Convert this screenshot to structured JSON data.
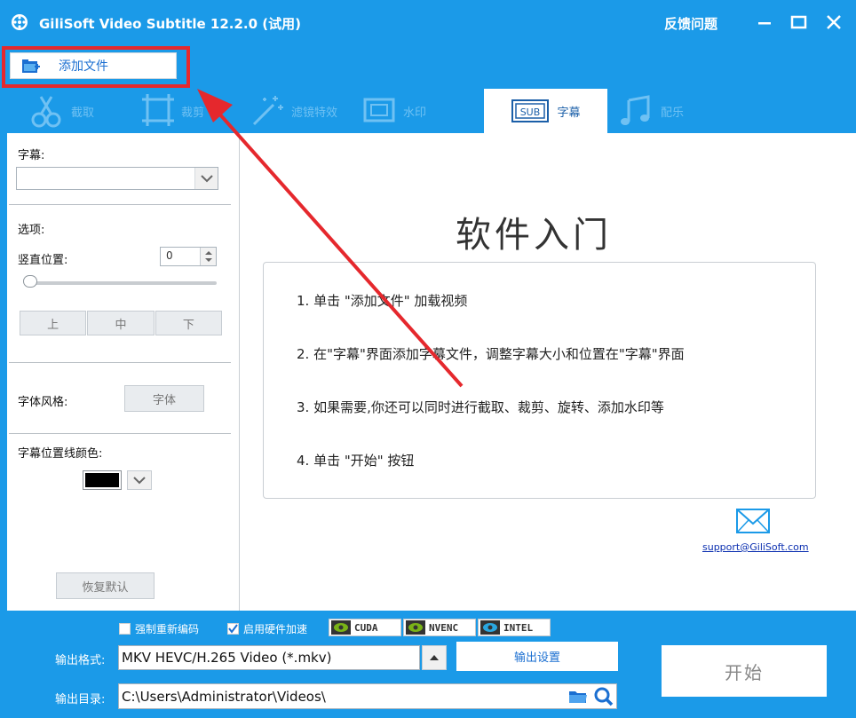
{
  "window": {
    "title": "GiliSoft Video Subtitle 12.2.0 (试用)",
    "feedback": "反馈问题"
  },
  "toolbar": {
    "add_file_label": "添加文件"
  },
  "tabs": [
    {
      "label": "截取"
    },
    {
      "label": "裁剪"
    },
    {
      "label": "滤镜特效"
    },
    {
      "label": "水印"
    },
    {
      "label": "字幕",
      "icon_text": "SUB"
    },
    {
      "label": "配乐"
    }
  ],
  "left_panel": {
    "subtitle_label": "字幕:",
    "subtitle_value": "",
    "options_label": "选项:",
    "vertical_position_label": "竖直位置:",
    "vertical_position_value": "0",
    "position_buttons": [
      "上",
      "中",
      "下"
    ],
    "font_style_label": "字体风格:",
    "font_button": "字体",
    "line_color_label": "字幕位置线颜色:",
    "line_color": "#000000",
    "reset_button": "恢复默认"
  },
  "guide": {
    "title": "软件入门",
    "steps": [
      "1. 单击 \"添加文件\" 加载视频",
      "2. 在\"字幕\"界面添加字幕文件，调整字幕大小和位置在\"字幕\"界面",
      "3. 如果需要,你还可以同时进行截取、裁剪、旋转、添加水印等",
      "4. 单击 \"开始\" 按钮"
    ],
    "support_email": "support@GiliSoft.com"
  },
  "bottom": {
    "force_reencode_label": "强制重新编码",
    "force_reencode_checked": false,
    "hw_accel_label": "启用硬件加速",
    "hw_accel_checked": true,
    "accelerators": [
      "CUDA",
      "NVENC",
      "INTEL"
    ],
    "output_format_label": "输出格式:",
    "output_format_value": "MKV HEVC/H.265 Video (*.mkv)",
    "output_settings_button": "输出设置",
    "output_dir_label": "输出目录:",
    "output_dir_value": "C:\\Users\\Administrator\\Videos\\",
    "start_button": "开始"
  },
  "colors": {
    "brand_blue": "#1b9ae8",
    "highlight_red": "#e5282d",
    "link_blue": "#0b2fb0"
  }
}
